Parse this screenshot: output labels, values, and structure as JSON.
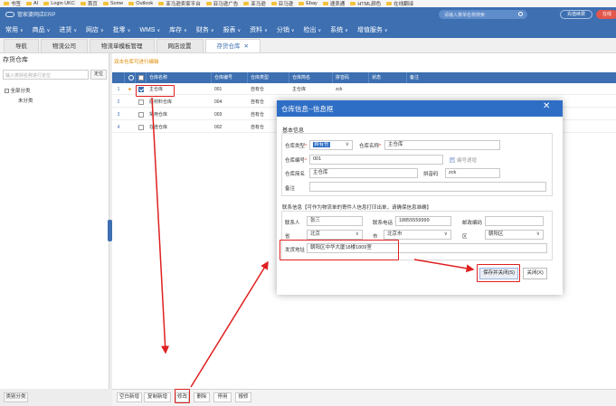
{
  "bookmarks": [
    "书签",
    "AI",
    "Login UKC",
    "首页",
    "Some",
    "Outlook",
    "亚马逊卖家平台",
    "亚马逊广告",
    "亚马逊",
    "亚马逊",
    "Ebay",
    "速卖通",
    "HTML颜色",
    "在线翻译"
  ],
  "topbar": {
    "logo_text": "管家婆网店ERP",
    "search_placeholder": "请输入菜单名称搜索",
    "renew_label": "充值续费",
    "red_label": "在线"
  },
  "menu": [
    "常用",
    "商品",
    "进货",
    "网店",
    "批零",
    "WMS",
    "库存",
    "财务",
    "报表",
    "资料",
    "分销",
    "检出",
    "系统",
    "增值服务"
  ],
  "tabs": [
    {
      "label": "导航",
      "active": false
    },
    {
      "label": "物流公司",
      "active": false
    },
    {
      "label": "物流单模板管理",
      "active": false
    },
    {
      "label": "网店设置",
      "active": false
    },
    {
      "label": "存货仓库",
      "active": true
    }
  ],
  "tab_close": "✕",
  "left_panel": {
    "title": "存货仓库",
    "search_placeholder": "输入类别名称进行定位",
    "locate_label": "定位",
    "tree_root": "全部分类",
    "tree_child": "未分类",
    "bottom_button": "类别分类"
  },
  "grid": {
    "note": "双击仓库可进行编辑",
    "columns": [
      "仓库名称",
      "仓库编号",
      "仓库类型",
      "仓库简名",
      "拼音码",
      "状态",
      "备注"
    ],
    "rows": [
      {
        "num": "1",
        "name": "主仓库",
        "code": "001",
        "type": "自有仓",
        "short": "主仓库",
        "pinyin": "zck",
        "checked": true
      },
      {
        "num": "2",
        "name": "原材料仓库",
        "code": "004",
        "type": "自有仓",
        "short": "",
        "pinyin": "",
        "checked": false
      },
      {
        "num": "3",
        "name": "常用仓库",
        "code": "003",
        "type": "自有仓",
        "short": "",
        "pinyin": "",
        "checked": false
      },
      {
        "num": "4",
        "name": "在途仓库",
        "code": "002",
        "type": "自有仓",
        "short": "",
        "pinyin": "",
        "checked": false
      }
    ],
    "row_marker": "►"
  },
  "bottom_toolbar": [
    "空白新增",
    "复制新增",
    "修改",
    "删除",
    "停用",
    "报修"
  ],
  "modal": {
    "title": "仓库信息--信息框",
    "close": "✕",
    "basic_title": "基本信息",
    "wh_type_label": "仓库类型",
    "wh_type_value": "自有仓",
    "wh_name_label": "仓库名称",
    "wh_name_value": "主仓库",
    "wh_code_label": "仓库编号",
    "wh_code_value": "001",
    "auto_code_label": "编号递增",
    "wh_short_label": "仓库简名",
    "wh_short_value": "主仓库",
    "pinyin_label": "拼音码",
    "pinyin_value": "zck",
    "remark_label": "备注",
    "remark_value": "",
    "contact_title": "联系信息【可作为物流单的寄件人信息打印出单，请确保信息准确】",
    "contact_person_label": "联系人",
    "contact_person_value": "张三",
    "phone_label": "联系电话",
    "phone_value": "18855559999",
    "zip_label": "邮政编码",
    "zip_value": "",
    "province_label": "省",
    "province_value": "北京",
    "city_label": "市",
    "city_value": "北京市",
    "district_label": "区",
    "district_value": "朝阳区",
    "address_label": "发货地址",
    "address_value": "朝阳区中华大厦18楼1809室",
    "save_label": "保存并关闭(S)",
    "close_label": "关闭(X)",
    "dropdown": "∨"
  },
  "annotation_color": "#e02020"
}
